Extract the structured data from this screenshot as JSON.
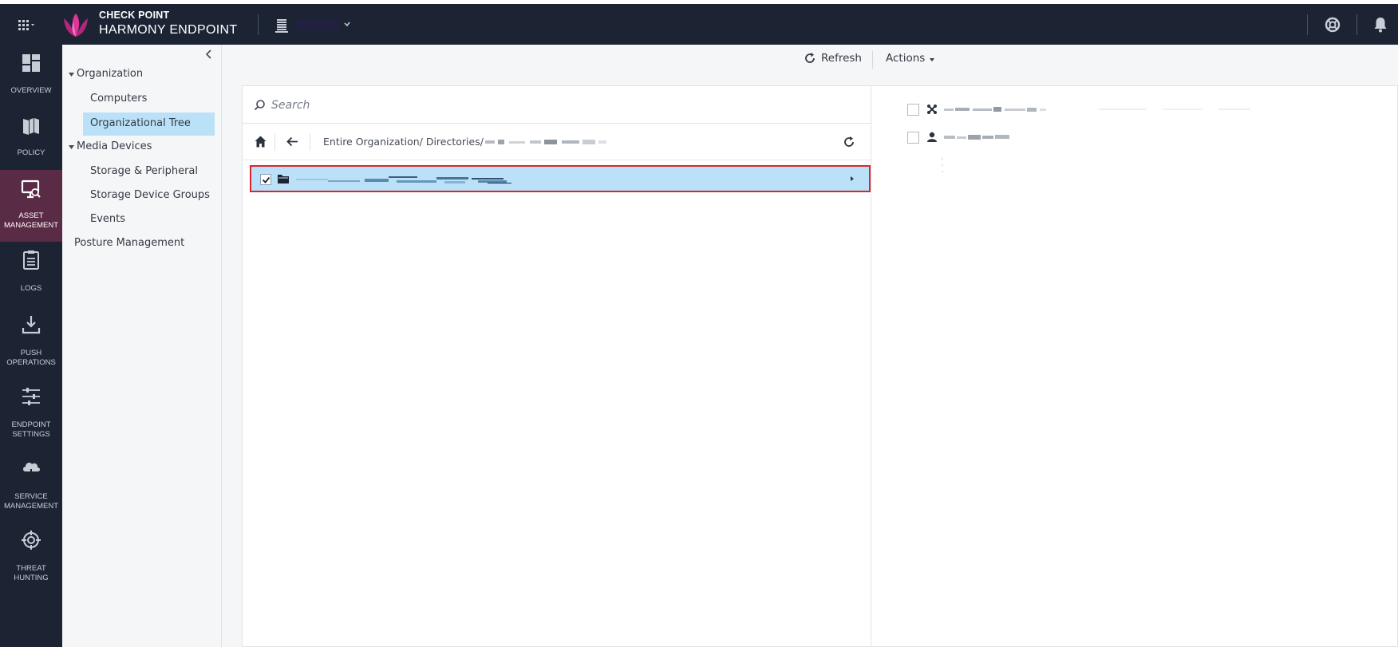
{
  "header": {
    "brand_top": "CHECK POINT",
    "brand_bottom": "HARMONY ENDPOINT"
  },
  "left_nav": [
    {
      "label": "OVERVIEW",
      "icon": "overview-icon"
    },
    {
      "label": "POLICY",
      "icon": "policy-icon"
    },
    {
      "label": "ASSET MANAGEMENT",
      "icon": "asset-management-icon",
      "active": true
    },
    {
      "label": "LOGS",
      "icon": "logs-icon"
    },
    {
      "label": "PUSH OPERATIONS",
      "icon": "push-operations-icon"
    },
    {
      "label": "ENDPOINT SETTINGS",
      "icon": "endpoint-settings-icon"
    },
    {
      "label": "SERVICE MANAGEMENT",
      "icon": "service-management-icon"
    },
    {
      "label": "THREAT HUNTING",
      "icon": "threat-hunting-icon"
    }
  ],
  "sidebar": {
    "organization": "Organization",
    "computers": "Computers",
    "organizational_tree": "Organizational Tree",
    "media_devices": "Media Devices",
    "storage_peripheral": "Storage & Peripheral",
    "storage_device_groups": "Storage Device Groups",
    "events": "Events",
    "posture_management": "Posture Management"
  },
  "toolbar": {
    "refresh": "Refresh",
    "actions": "Actions"
  },
  "search": {
    "placeholder": "Search"
  },
  "breadcrumb": {
    "path": "Entire Organization/ Directories/"
  },
  "colors": {
    "header_bg": "#1c2434",
    "active_nav": "#5a2b44",
    "selection": "#bbe1f8",
    "highlight_border": "#d9262e"
  }
}
